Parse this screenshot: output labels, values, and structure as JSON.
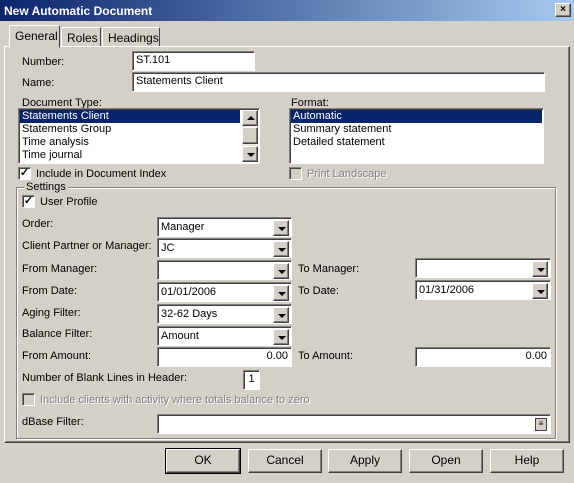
{
  "window": {
    "title": "New Automatic Document",
    "close_label": "×"
  },
  "tabs": [
    {
      "label": "General"
    },
    {
      "label": "Roles"
    },
    {
      "label": "Headings"
    }
  ],
  "general": {
    "number_label": "Number:",
    "number_value": "ST.101",
    "name_label": "Name:",
    "name_value": "Statements Client",
    "doc_type_label": "Document Type:",
    "doc_type_items": [
      "Statements Client",
      "Statements Group",
      "Time analysis",
      "Time journal"
    ],
    "doc_type_selected": "Statements Client",
    "format_label": "Format:",
    "format_items": [
      "Automatic",
      "Summary statement",
      "Detailed statement"
    ],
    "format_selected": "Automatic",
    "include_index_label": "Include in Document Index",
    "include_index_checked": true,
    "print_landscape_label": "Print Landscape",
    "print_landscape_checked": false
  },
  "settings": {
    "title": "Settings",
    "user_profile_label": "User Profile",
    "user_profile_checked": true,
    "order_label": "Order:",
    "order_value": "Manager",
    "client_partner_label": "Client Partner or Manager:",
    "client_partner_value": "JC",
    "from_manager_label": "From Manager:",
    "from_manager_value": "",
    "to_manager_label": "To Manager:",
    "to_manager_value": "",
    "from_date_label": "From Date:",
    "from_date_value": "01/01/2006",
    "to_date_label": "To Date:",
    "to_date_value": "01/31/2006",
    "aging_filter_label": "Aging Filter:",
    "aging_filter_value": "32-62 Days",
    "balance_filter_label": "Balance Filter:",
    "balance_filter_value": "Amount",
    "from_amount_label": "From Amount:",
    "from_amount_value": "0.00",
    "to_amount_label": "To Amount:",
    "to_amount_value": "0.00",
    "blank_lines_label": "Number of Blank Lines in Header:",
    "blank_lines_value": "1",
    "include_clients_label": "Include clients with activity where totals balance to zero",
    "dbase_filter_label": "dBase Filter:",
    "dbase_filter_value": ""
  },
  "buttons": {
    "ok": "OK",
    "cancel": "Cancel",
    "apply": "Apply",
    "open": "Open",
    "help": "Help"
  }
}
